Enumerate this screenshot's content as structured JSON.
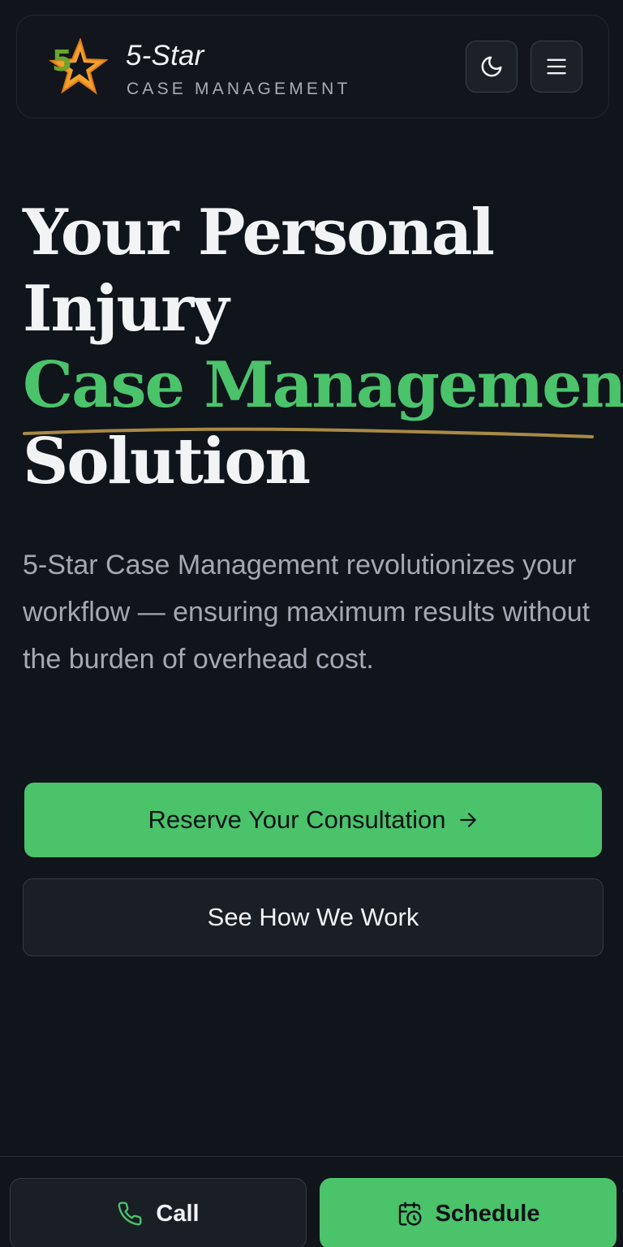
{
  "header": {
    "logo_digit": "5",
    "brand_name": "5-Star",
    "brand_sub": "CASE MANAGEMENT",
    "theme_icon": "moon-icon",
    "menu_icon": "hamburger-menu-icon"
  },
  "hero": {
    "title_line1": "Your Personal",
    "title_line2": "Injury",
    "title_highlight": "Case Management",
    "title_line4": "Solution",
    "description": "5-Star Case Management revolutionizes your workflow — ensuring maximum results without the burden of overhead cost.",
    "primary_cta": "Reserve Your Consultation",
    "primary_cta_icon": "arrow-right-icon",
    "secondary_cta": "See How We Work"
  },
  "bottom_bar": {
    "call_label": "Call",
    "call_icon": "phone-icon",
    "schedule_label": "Schedule",
    "schedule_icon": "calendar-clock-icon"
  },
  "colors": {
    "background": "#10141b",
    "accent_green": "#4ac36b",
    "underline_gold": "#a88a45",
    "muted_text": "#a3a9b3"
  }
}
